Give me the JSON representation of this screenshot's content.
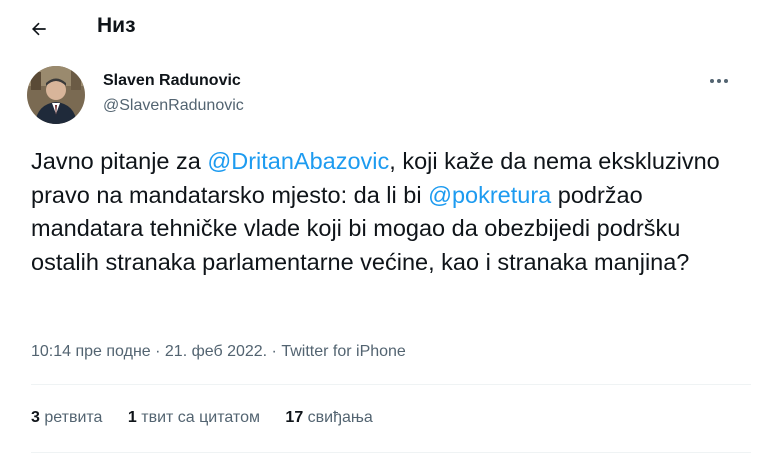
{
  "header": {
    "back_icon": "arrow-left-icon",
    "title": "Низ"
  },
  "author": {
    "name": "Slaven Radunovic",
    "handle": "@SlavenRadunovic",
    "more_icon": "more-horizontal-icon"
  },
  "tweet": {
    "text_1": "Javno pitanje za ",
    "mention_1": "@DritanAbazovic",
    "text_2": ", koji kaže da nema ekskluzivno pravo na mandatarsko mjesto: da li bi ",
    "mention_2": "@pokretura",
    "text_3": " podržao mandatara tehničke vlade koji bi mogao da obezbijedi podršku ostalih stranaka parlamentarne većine, kao i stranaka manjina?"
  },
  "meta": {
    "time": "10:14 пре подне",
    "separator": " · ",
    "date": "21. феб 2022.",
    "separator2": " · ",
    "source": "Twitter for iPhone"
  },
  "stats": {
    "retweets_count": "3",
    "retweets_label": " ретвита",
    "quotes_count": "1",
    "quotes_label": " твит са цитатом",
    "likes_count": "17",
    "likes_label": " свиђања"
  },
  "colors": {
    "link": "#1d9bf0",
    "secondary": "#536471",
    "text": "#0f1419",
    "divider": "#eff3f4"
  }
}
